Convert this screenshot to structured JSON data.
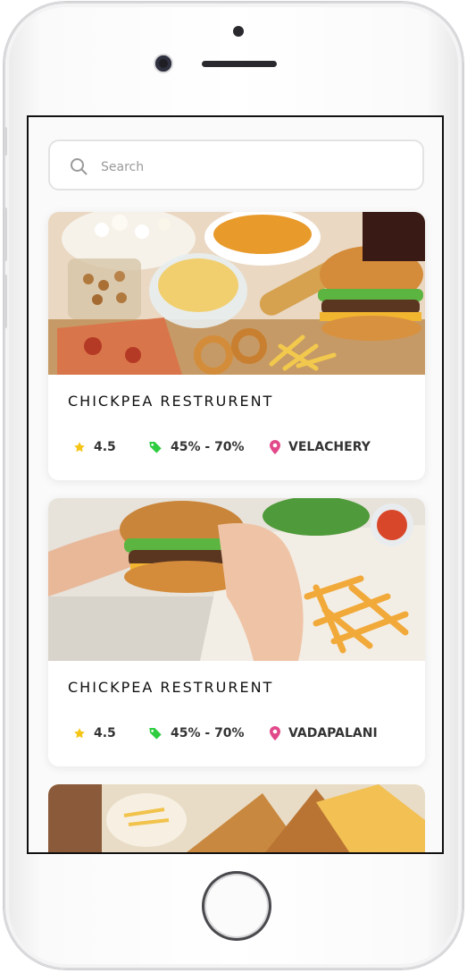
{
  "search": {
    "placeholder": "Search"
  },
  "restaurants": [
    {
      "name": "CHICKPEA RESTRURENT",
      "rating": "4.5",
      "offer": "45% - 70%",
      "location": "VELACHERY"
    },
    {
      "name": "CHICKPEA RESTRURENT",
      "rating": "4.5",
      "offer": "45% - 70%",
      "location": "VADAPALANI"
    }
  ],
  "icons": {
    "rating": "star-icon",
    "offer": "tag-icon",
    "location": "location-pin-icon",
    "search": "search-icon"
  },
  "colors": {
    "star": "#f5c518",
    "tag": "#2ecc40",
    "pin": "#e2498a"
  }
}
